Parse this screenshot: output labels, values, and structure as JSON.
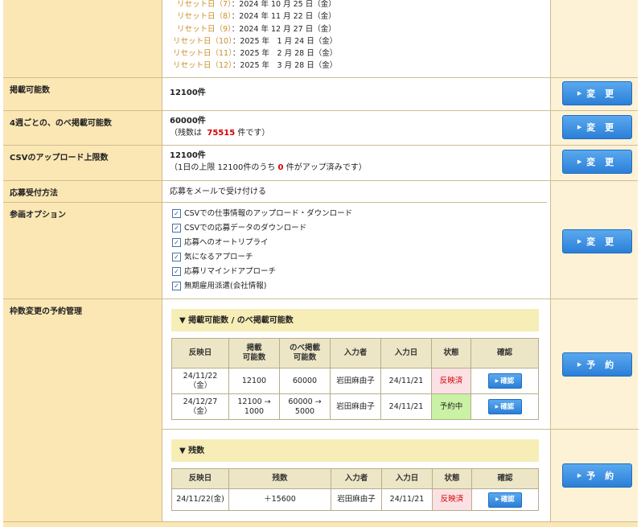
{
  "reset_dates": [
    {
      "label": "リセット日（7）",
      "value": "：2024 年 10 月 25 日（金）"
    },
    {
      "label": "リセット日（8）",
      "value": "：2024 年 11 月 22 日（金）"
    },
    {
      "label": "リセット日（9）",
      "value": "：2024 年 12 月 27 日（金）"
    },
    {
      "label": "リセット日（10）",
      "value": "：2025 年　1 月 24 日（金）"
    },
    {
      "label": "リセット日（11）",
      "value": "：2025 年　2 月 28 日（金）"
    },
    {
      "label": "リセット日（12）",
      "value": "：2025 年　3 月 28 日（金）"
    }
  ],
  "rows": {
    "postable": {
      "label": "掲載可能数",
      "value": "12100件"
    },
    "weekly": {
      "label": "4週ごとの、のべ掲載可能数",
      "value": "60000件",
      "sub_prefix": "（残数は",
      "remaining": "75515",
      "sub_suffix": "件です）"
    },
    "csv": {
      "label": "CSVのアップロード上限数",
      "value": "12100件",
      "sub_prefix": "（1日の上限 12100件のうち",
      "uploaded": "0",
      "sub_suffix": "件がアップ済みです）"
    },
    "apply": {
      "label": "応募受付方法",
      "value": "応募をメールで受け付ける"
    },
    "options": {
      "label": "参画オプション",
      "items": [
        "CSVでの仕事情報のアップロード・ダウンロード",
        "CSVでの応募データのダウンロード",
        "応募へのオートリプライ",
        "気になるアプローチ",
        "応募リマインドアプローチ",
        "無期雇用派遣(会社情報)"
      ]
    },
    "reserve": {
      "label": "枠数変更の予約管理"
    }
  },
  "buttons": {
    "change": "変 更",
    "reserve": "予 約",
    "confirm": "確認",
    "tri": "▶"
  },
  "section1": {
    "title": "▼ 掲載可能数 / のべ掲載可能数",
    "headers": [
      "反映日",
      "掲載\n可能数",
      "のべ掲載\n可能数",
      "入力者",
      "入力日",
      "状態",
      "確認"
    ],
    "rows": [
      {
        "date": "24/11/22\n（金）",
        "posts": "12100",
        "total": "60000",
        "user": "岩田麻由子",
        "entry": "24/11/21",
        "status": "反映済"
      },
      {
        "date": "24/12/27\n（金）",
        "posts": "12100 →\n1000",
        "total": "60000 →\n5000",
        "user": "岩田麻由子",
        "entry": "24/11/21",
        "status": "予約中"
      }
    ]
  },
  "section2": {
    "title": "▼ 残数",
    "headers": [
      "反映日",
      "残数",
      "入力者",
      "入力日",
      "状態",
      "確認"
    ],
    "rows": [
      {
        "date": "24/11/22(金)",
        "remaining": "＋15600",
        "user": "岩田麻由子",
        "entry": "24/11/21",
        "status": "反映済"
      }
    ]
  },
  "colors": {
    "label_bg": "#fbe7b4",
    "button": "#2b7fd7",
    "accent_red": "#d20000",
    "section_bg": "#f6edb7"
  }
}
